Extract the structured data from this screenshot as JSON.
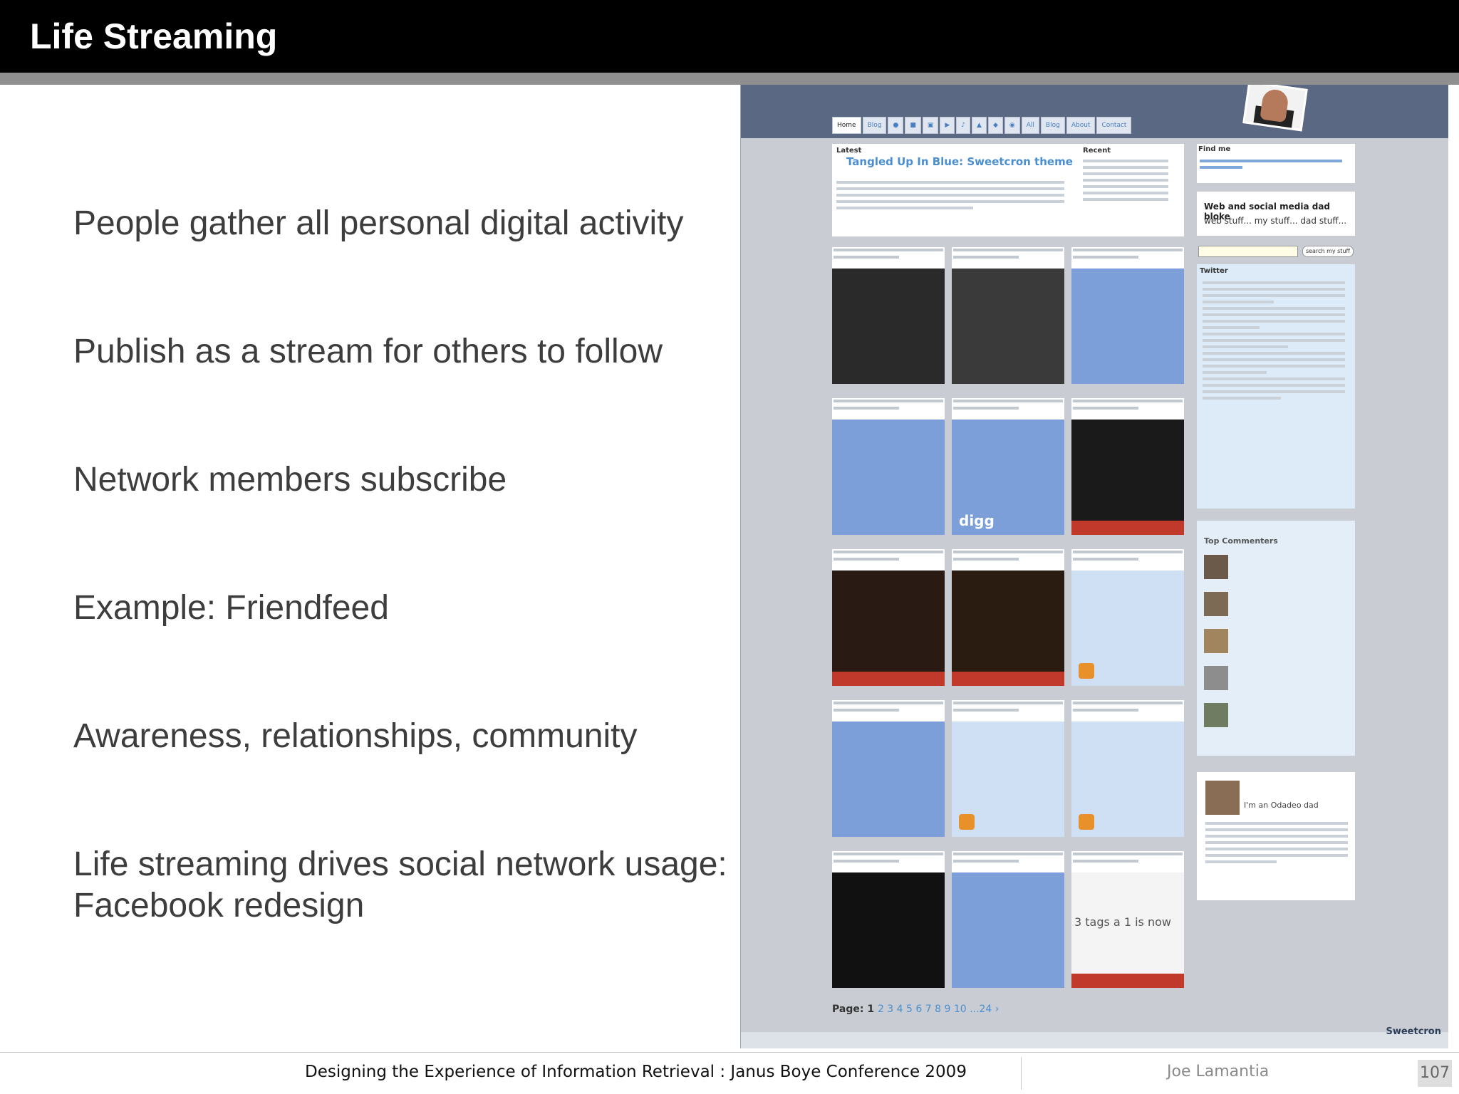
{
  "slide": {
    "title": "Life Streaming",
    "bullets": [
      "People gather all personal digital activity",
      "Publish as a stream for others to follow",
      "Network members subscribe",
      "Example: Friendfeed",
      "Awareness, relationships, community",
      "Life streaming drives social network usage:",
      "Facebook redesign"
    ]
  },
  "screenshot": {
    "nav_tabs": [
      "Home",
      "Blog",
      "",
      "",
      "",
      "",
      "",
      "",
      "",
      "",
      "All",
      "Blog",
      "About",
      "Contact"
    ],
    "latest_label": "Latest",
    "recent_label": "Recent",
    "post_title": "Tangled Up In Blue: Sweetcron theme",
    "find_me_label": "Find me",
    "tagline_title": "Web and social media dad bloke",
    "tagline_sub": "web stuff... my stuff... dad stuff...",
    "search_button": "search my stuff",
    "twitter_label": "Twitter",
    "top_commenters_label": "Top Commenters",
    "dad_label": "I'm an Odadeo dad",
    "pager_label": "Page:",
    "pager_current": "1",
    "pager_numbers": "2 3 4 5 6 7 8 9 10 ...24 ›",
    "powered_by": "Sweetcron",
    "digg_label": "digg",
    "tags_text": "3 tags a  1 is now"
  },
  "footer": {
    "conference": "Designing the Experience of Information Retrieval : Janus Boye Conference 2009",
    "author": "Joe Lamantia",
    "page_number": "107"
  },
  "colors": {
    "title_bar": "#000000",
    "title_strip": "#8f8f8f",
    "bullet_text": "#3d3d3d",
    "tile_blue": "#7c9fd9",
    "link_blue": "#4a8fd1"
  }
}
